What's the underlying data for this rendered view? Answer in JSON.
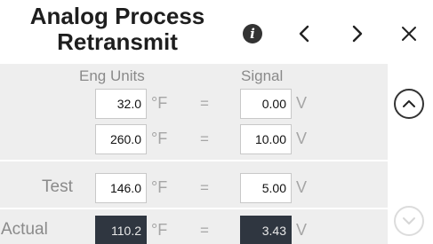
{
  "header": {
    "title_line1": "Analog Process",
    "title_line2": "Retransmit",
    "info_icon": "info-icon",
    "prev_icon": "chevron-left-icon",
    "next_icon": "chevron-right-icon",
    "close_icon": "close-icon"
  },
  "columns": {
    "eng_units": "Eng Units",
    "signal": "Signal"
  },
  "rows": {
    "low": {
      "eng_value": "32.0",
      "eng_unit": "°F",
      "equals": "=",
      "signal_value": "0.00",
      "signal_unit": "V"
    },
    "high": {
      "eng_value": "260.0",
      "eng_unit": "°F",
      "equals": "=",
      "signal_value": "10.00",
      "signal_unit": "V"
    },
    "test": {
      "label": "Test",
      "eng_value": "146.0",
      "eng_unit": "°F",
      "equals": "=",
      "signal_value": "5.00",
      "signal_unit": "V"
    },
    "actual": {
      "label": "Actual",
      "eng_value": "110.2",
      "eng_unit": "°F",
      "equals": "=",
      "signal_value": "3.43",
      "signal_unit": "V"
    }
  },
  "scroll": {
    "up_icon": "chevron-up-icon",
    "down_icon": "chevron-down-icon"
  },
  "colors": {
    "panel_bg": "#eeeeee",
    "field_dark": "#2f3640",
    "muted_text": "#8a8a8a"
  }
}
